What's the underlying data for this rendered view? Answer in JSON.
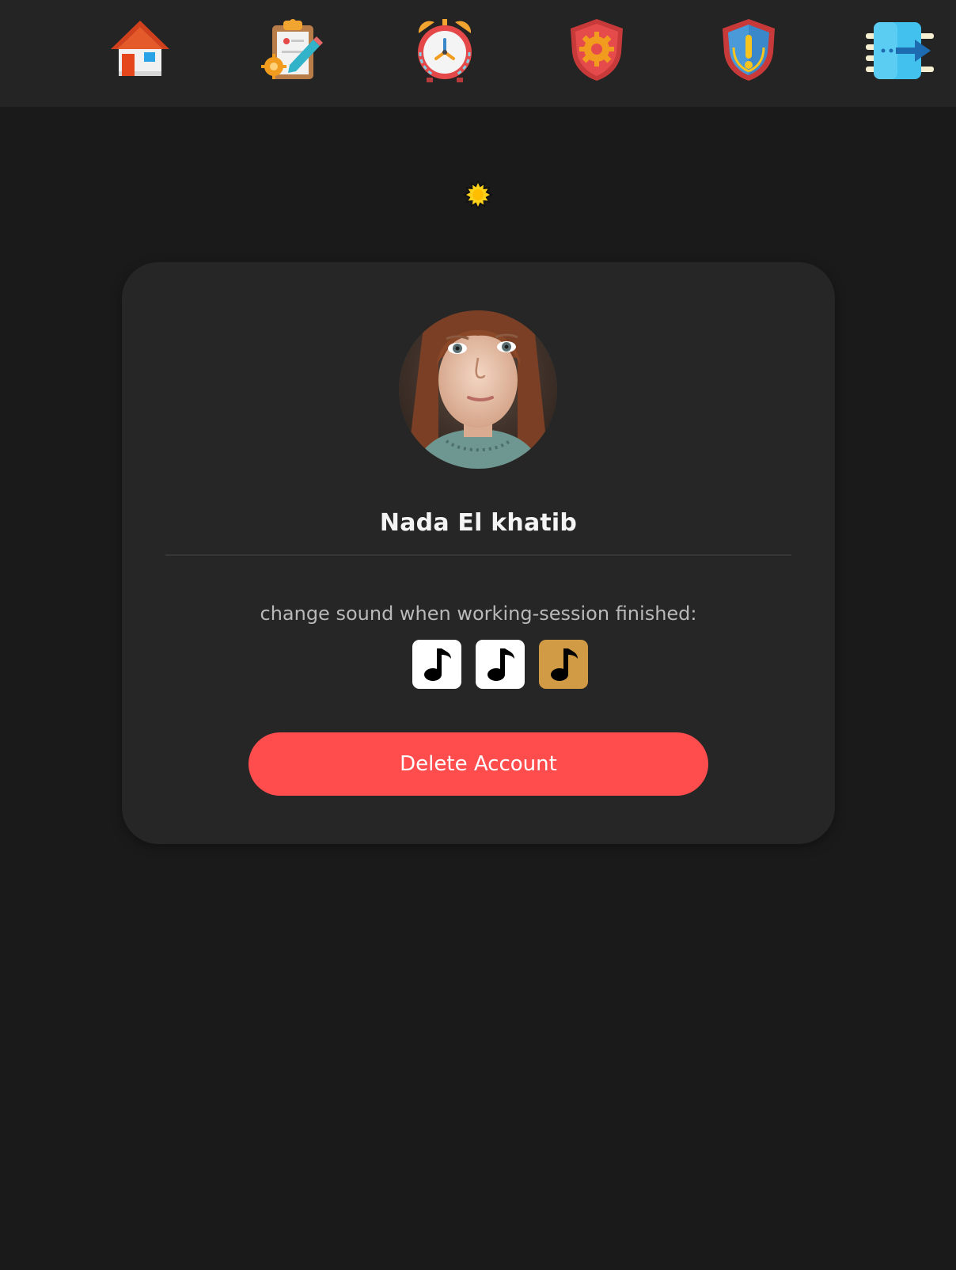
{
  "nav": {
    "items": [
      {
        "icon": "home-icon"
      },
      {
        "icon": "task-settings-icon"
      },
      {
        "icon": "alarm-clock-icon"
      },
      {
        "icon": "shield-gear-icon"
      },
      {
        "icon": "shield-warning-icon"
      },
      {
        "icon": "logout-icon"
      }
    ]
  },
  "theme_toggle": {
    "icon": "sun-icon"
  },
  "profile": {
    "avatar_icon": "avatar",
    "name": "Nada El khatib",
    "sound_label": "change sound when working-session finished:",
    "sounds": [
      {
        "icon": "music-note-icon",
        "selected": false
      },
      {
        "icon": "music-note-icon",
        "selected": false
      },
      {
        "icon": "music-note-icon",
        "selected": true
      }
    ],
    "delete_label": "Delete Account"
  },
  "colors": {
    "background": "#1a1a1a",
    "navbar": "#242424",
    "card": "#262626",
    "danger": "#ff4c4d",
    "selected_sound": "#d19a45"
  }
}
